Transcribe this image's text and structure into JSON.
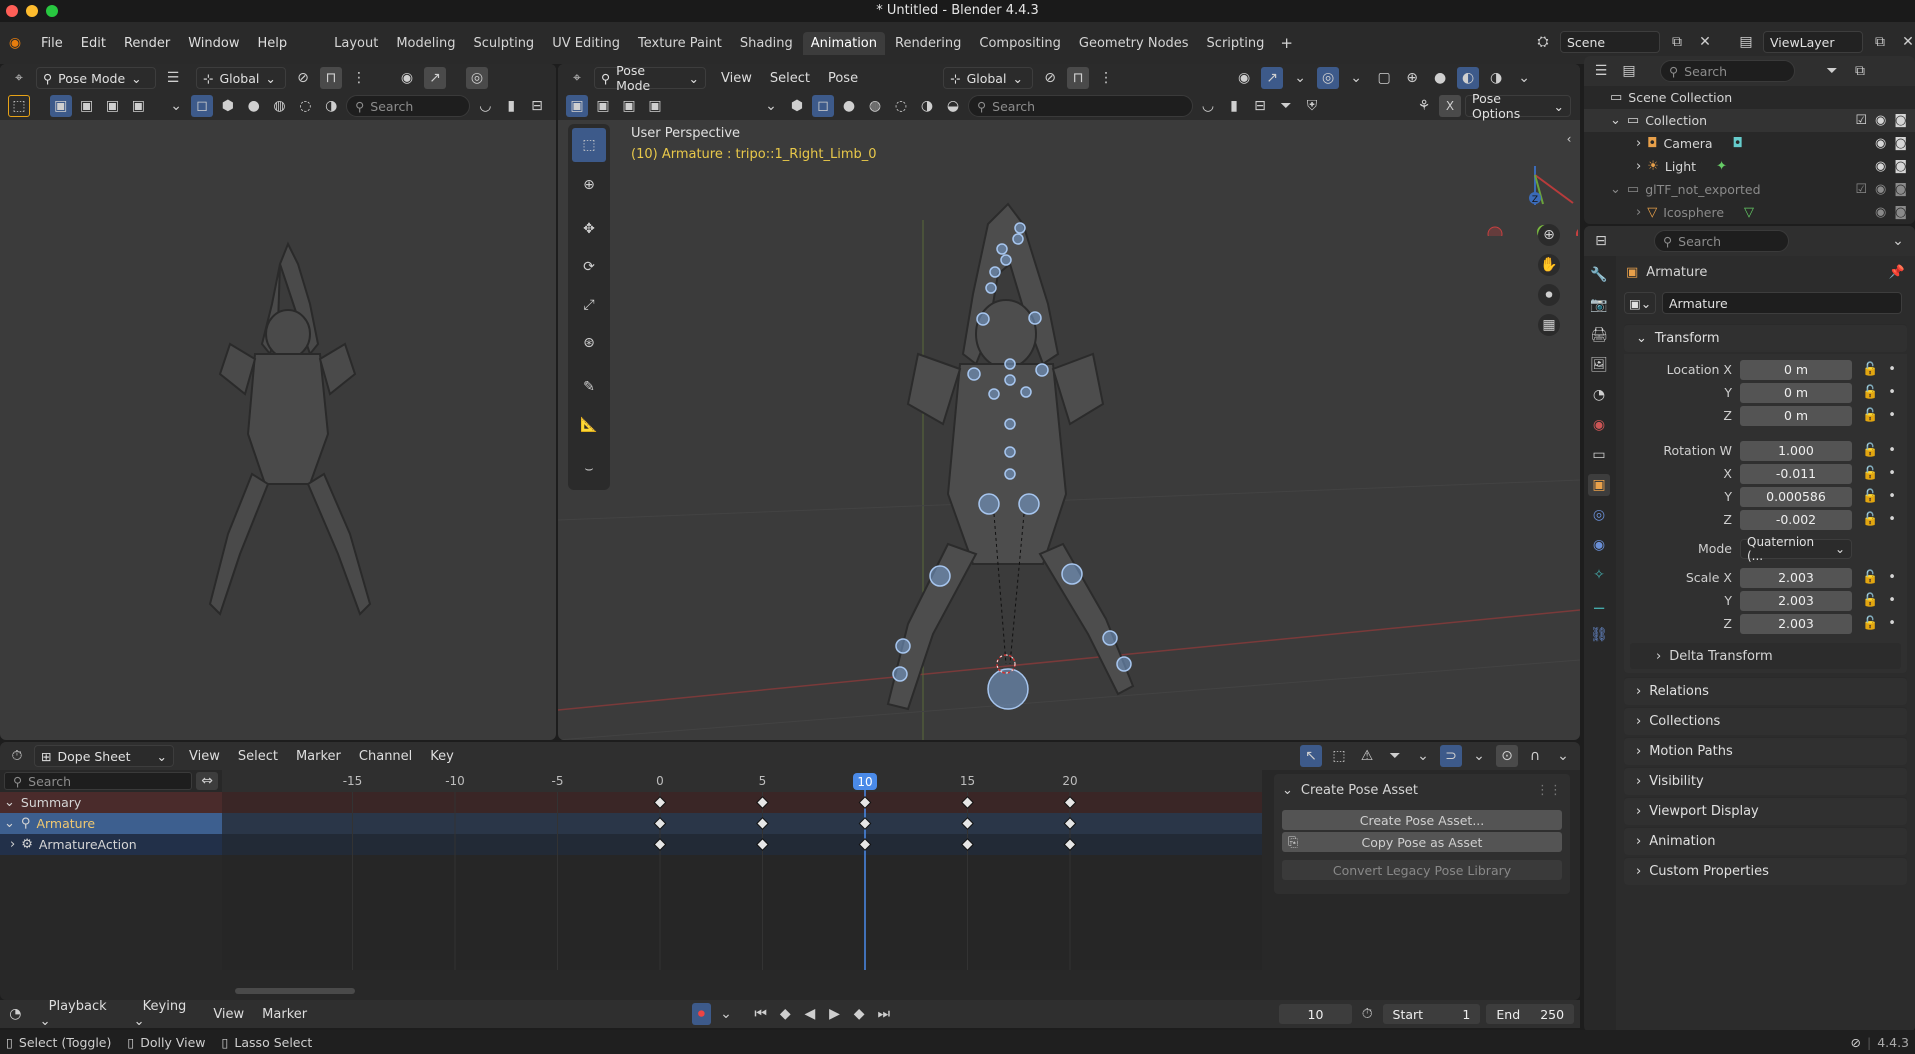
{
  "window": {
    "title": "* Untitled - Blender 4.4.3"
  },
  "menu": {
    "items": [
      "File",
      "Edit",
      "Render",
      "Window",
      "Help"
    ]
  },
  "workspaces": {
    "tabs": [
      "Layout",
      "Modeling",
      "Sculpting",
      "UV Editing",
      "Texture Paint",
      "Shading",
      "Animation",
      "Rendering",
      "Compositing",
      "Geometry Nodes",
      "Scripting"
    ],
    "active": "Animation"
  },
  "scene": {
    "label": "Scene"
  },
  "viewlayer": {
    "label": "ViewLayer"
  },
  "left_view": {
    "mode": "Pose Mode",
    "orientation": "Global",
    "search_placeholder": "Search"
  },
  "main_view": {
    "mode": "Pose Mode",
    "menus": [
      "View",
      "Select",
      "Pose"
    ],
    "orientation": "Global",
    "search_placeholder": "Search",
    "pose_options": "Pose Options",
    "overlay_title": "User Perspective",
    "overlay_subtitle": "(10) Armature : tripo::1_Right_Limb_0",
    "gizmo": {
      "x": "X",
      "y": "Y",
      "z": "Z"
    }
  },
  "outliner": {
    "search_placeholder": "Search",
    "items": [
      {
        "name": "Scene Collection",
        "indent": 0
      },
      {
        "name": "Collection",
        "indent": 1
      },
      {
        "name": "Camera",
        "indent": 2
      },
      {
        "name": "Light",
        "indent": 2
      },
      {
        "name": "glTF_not_exported",
        "indent": 1
      },
      {
        "name": "Icosphere",
        "indent": 2
      }
    ]
  },
  "properties": {
    "search_placeholder": "Search",
    "object_name": "Armature",
    "data_name": "Armature",
    "transform_label": "Transform",
    "location": {
      "label_x": "Location X",
      "label_y": "Y",
      "label_z": "Z",
      "x": "0 m",
      "y": "0 m",
      "z": "0 m"
    },
    "rotation": {
      "label_w": "Rotation W",
      "label_x": "X",
      "label_y": "Y",
      "label_z": "Z",
      "w": "1.000",
      "x": "-0.011",
      "y": "0.000586",
      "z": "-0.002"
    },
    "mode": {
      "label": "Mode",
      "value": "Quaternion (..."
    },
    "scale": {
      "label_x": "Scale X",
      "label_y": "Y",
      "label_z": "Z",
      "x": "2.003",
      "y": "2.003",
      "z": "2.003"
    },
    "panels": [
      "Delta Transform",
      "Relations",
      "Collections",
      "Motion Paths",
      "Visibility",
      "Viewport Display",
      "Animation",
      "Custom Properties"
    ]
  },
  "dopesheet": {
    "mode": "Dope Sheet",
    "menus": [
      "View",
      "Select",
      "Marker",
      "Channel",
      "Key"
    ],
    "search_placeholder": "Search",
    "channels": [
      "Summary",
      "Armature",
      "ArmatureAction"
    ],
    "ruler": [
      "-15",
      "-10",
      "-5",
      "0",
      "5",
      "10",
      "15",
      "20"
    ],
    "current_frame": "10",
    "keyframes": [
      0,
      5,
      10,
      15,
      20
    ]
  },
  "pose_asset": {
    "title": "Create Pose Asset",
    "create_btn": "Create Pose Asset...",
    "copy_btn": "Copy Pose as Asset",
    "convert_btn": "Convert Legacy Pose Library"
  },
  "timeline": {
    "menus": [
      "Playback",
      "Keying",
      "View",
      "Marker"
    ],
    "frame": "10",
    "start_label": "Start",
    "start": "1",
    "end_label": "End",
    "end": "250"
  },
  "statusbar": {
    "items": [
      "Select (Toggle)",
      "Dolly View",
      "Lasso Select"
    ],
    "version": "4.4.3"
  }
}
